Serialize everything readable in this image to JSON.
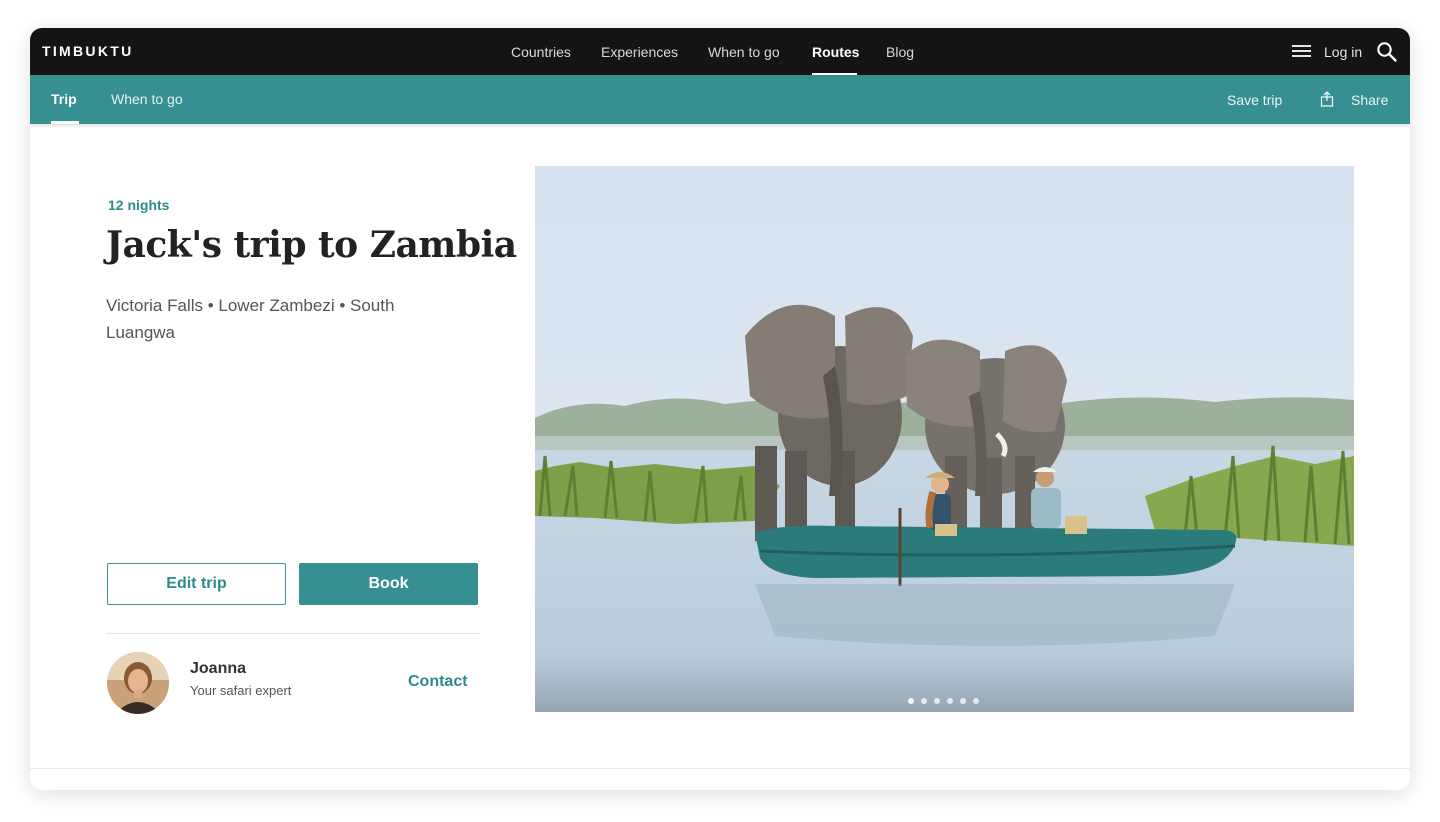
{
  "brand": "TIMBUKTU",
  "topnav": {
    "links": [
      "Countries",
      "Experiences",
      "When to go",
      "Routes",
      "Blog"
    ],
    "active": "Routes",
    "login": "Log in"
  },
  "subnav": {
    "tabs": [
      "Trip",
      "When to go"
    ],
    "active": "Trip",
    "save_trip": "Save trip",
    "share": "Share"
  },
  "trip": {
    "nights": "12 nights",
    "title": "Jack's trip to Zambia",
    "route": "Victoria Falls • Lower Zambezi • South Luangwa"
  },
  "actions": {
    "edit": "Edit trip",
    "book": "Book"
  },
  "expert": {
    "name": "Joanna",
    "role": "Your safari expert",
    "contact": "Contact"
  },
  "gallery": {
    "slide_count": 6,
    "active_slide": 1
  },
  "colors": {
    "accent": "#368f90",
    "topnav_bg": "#141414"
  },
  "icons": [
    "menu-icon",
    "search-icon",
    "share-icon"
  ]
}
